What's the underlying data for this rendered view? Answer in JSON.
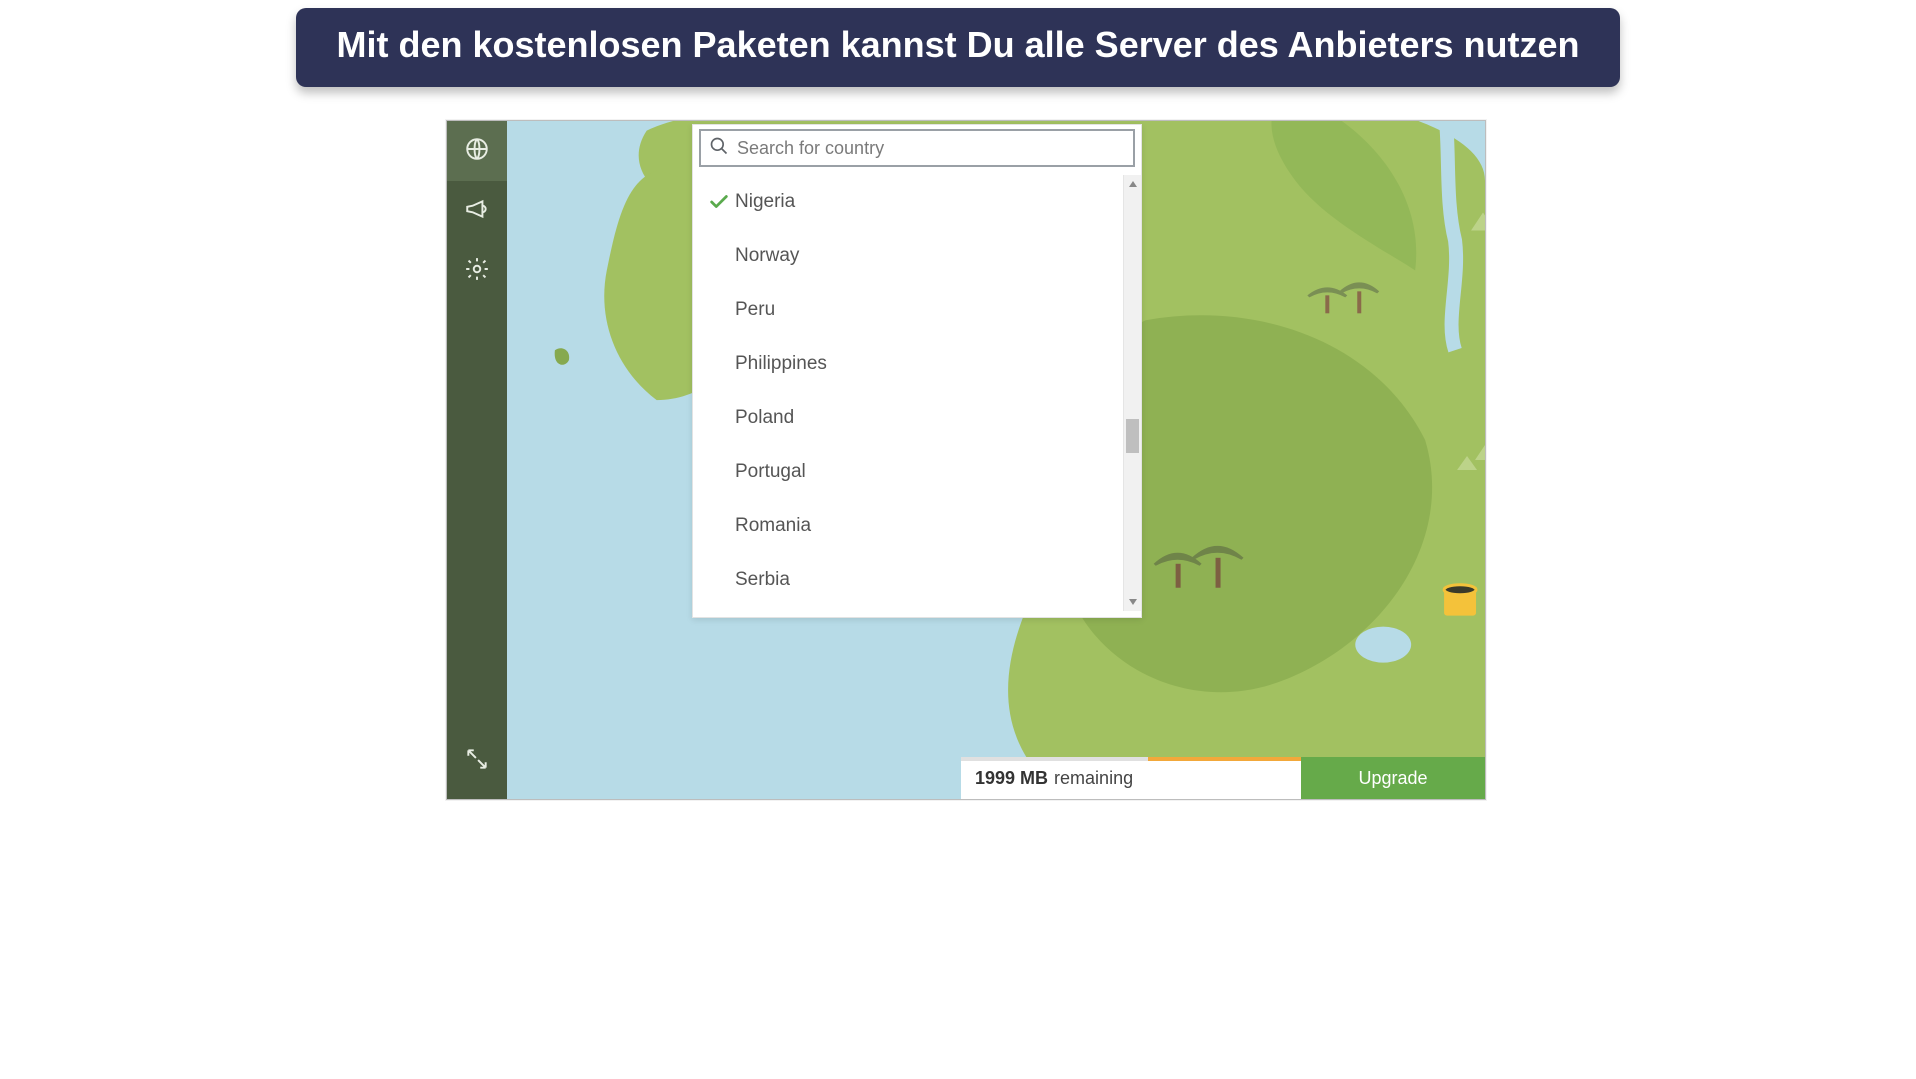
{
  "banner": {
    "text": "Mit den kostenlosen Paketen kannst Du alle Server des Anbieters nutzen"
  },
  "sidebar": {
    "items": [
      {
        "name": "globe-icon",
        "active": true
      },
      {
        "name": "megaphone-icon",
        "active": false
      },
      {
        "name": "gear-icon",
        "active": false
      }
    ],
    "collapse": {
      "name": "collapse-icon"
    }
  },
  "search": {
    "placeholder": "Search for country",
    "value": ""
  },
  "countries": [
    {
      "name": "Nigeria",
      "selected": true
    },
    {
      "name": "Norway",
      "selected": false
    },
    {
      "name": "Peru",
      "selected": false
    },
    {
      "name": "Philippines",
      "selected": false
    },
    {
      "name": "Poland",
      "selected": false
    },
    {
      "name": "Portugal",
      "selected": false
    },
    {
      "name": "Romania",
      "selected": false
    },
    {
      "name": "Serbia",
      "selected": false
    }
  ],
  "status": {
    "amount": "1999 MB",
    "remaining_label": "remaining",
    "upgrade_label": "Upgrade"
  },
  "colors": {
    "banner_bg": "#2e3357",
    "sidebar_bg": "#4a5a3f",
    "land": "#a2c161",
    "land_dark": "#8fb153",
    "water": "#b7dbe7",
    "accent_green": "#66aa4a",
    "accent_orange": "#f2a83a"
  }
}
